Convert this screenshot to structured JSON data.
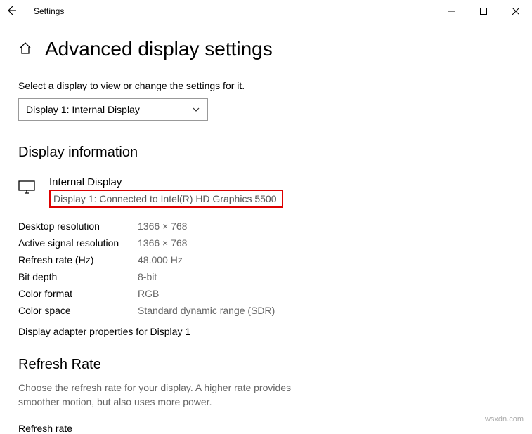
{
  "window": {
    "title": "Settings"
  },
  "page": {
    "title": "Advanced display settings",
    "select_prompt": "Select a display to view or change the settings for it.",
    "selected_display": "Display 1: Internal Display"
  },
  "display_info": {
    "section_title": "Display information",
    "name": "Internal Display",
    "connection": "Display 1: Connected to Intel(R) HD Graphics 5500",
    "rows": {
      "desktop_res_label": "Desktop resolution",
      "desktop_res_value": "1366 × 768",
      "active_res_label": "Active signal resolution",
      "active_res_value": "1366 × 768",
      "refresh_label": "Refresh rate (Hz)",
      "refresh_value": "48.000 Hz",
      "bitdepth_label": "Bit depth",
      "bitdepth_value": "8-bit",
      "colorfmt_label": "Color format",
      "colorfmt_value": "RGB",
      "colorspace_label": "Color space",
      "colorspace_value": "Standard dynamic range (SDR)"
    },
    "adapter_link": "Display adapter properties for Display 1"
  },
  "refresh_section": {
    "title": "Refresh Rate",
    "desc": "Choose the refresh rate for your display. A higher rate provides smoother motion, but also uses more power.",
    "label": "Refresh rate"
  },
  "watermark": "wsxdn.com"
}
